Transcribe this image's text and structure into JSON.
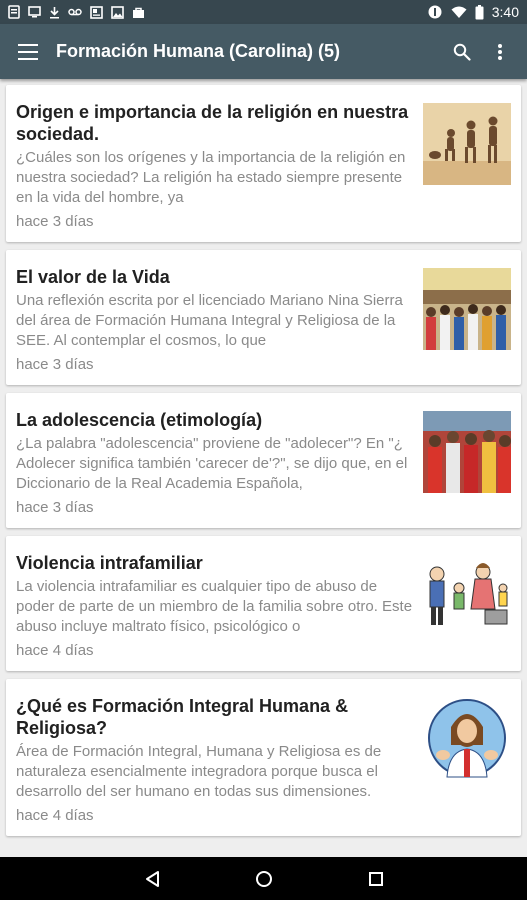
{
  "status_bar": {
    "time": "3:40",
    "left_icons": [
      "notification-icon",
      "screen-icon",
      "download-icon",
      "voicemail-icon",
      "news-icon",
      "photo-icon",
      "bag-icon"
    ],
    "right_icons": [
      "vibrate-icon",
      "wifi-icon",
      "battery-icon"
    ]
  },
  "app_bar": {
    "title": "Formación Humana (Carolina) (5)",
    "background": "#455a64"
  },
  "articles": [
    {
      "title": "Origen e importancia de la religión en nuestra sociedad.",
      "summary": "¿Cuáles son los orígenes y la importancia de la religión en nuestra sociedad? La religión ha estado siempre presente en la vida del hombre, ya",
      "date": "hace 3 días",
      "thumbnail": "evolution-image"
    },
    {
      "title": "El valor de la Vida",
      "summary": "Una reflexión escrita por el licenciado Mariano Nina Sierra del área de Formación Humana Integral y Religiosa de la SEE. Al contemplar el cosmos, lo que",
      "date": "hace 3 días",
      "thumbnail": "crowd-image"
    },
    {
      "title": "La adolescencia (etimología)",
      "summary": "¿La palabra \"adolescencia\" proviene de \"adolecer\"? En \"¿ Adolecer  significa también 'carecer de'?\", se dijo que, en el  Diccionario  de la Real Academia Española,",
      "date": "hace 3 días",
      "thumbnail": "teens-image"
    },
    {
      "title": "Violencia intrafamiliar",
      "summary": "La violencia intrafamiliar es cualquier tipo de abuso de poder de parte de un miembro de la familia sobre otro. Este abuso incluye maltrato físico, psicológico o",
      "date": "hace 4 días",
      "thumbnail": "family-cartoon-image"
    },
    {
      "title": "¿Qué es Formación Integral Humana & Religiosa?",
      "summary": "Área de Formación Integral, Humana y Religiosa es de naturaleza esencialmente integradora porque busca el desarrollo del ser humano en todas sus dimensiones.",
      "date": "hace 4 días",
      "thumbnail": "jesus-cartoon-image"
    }
  ]
}
